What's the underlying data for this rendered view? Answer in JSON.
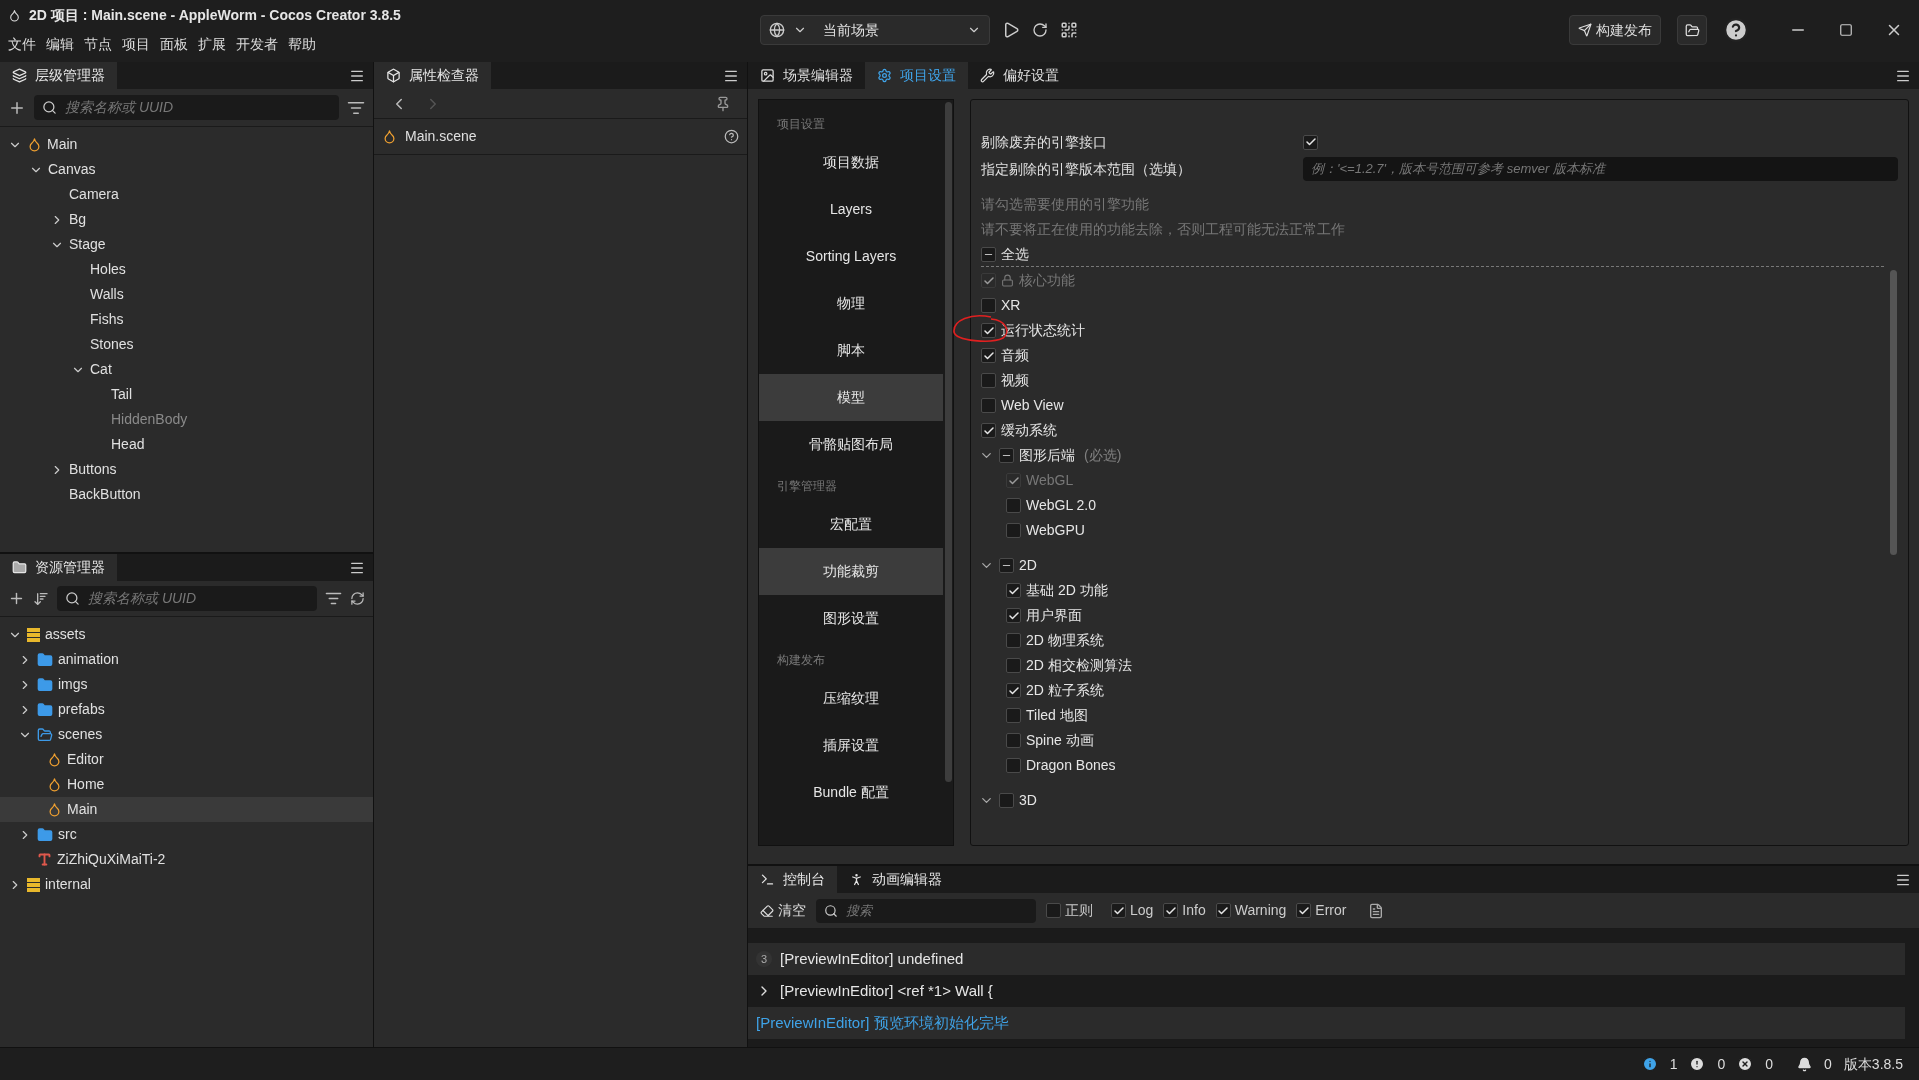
{
  "window": {
    "title": "2D 项目 : Main.scene - AppleWorm - Cocos Creator 3.8.5"
  },
  "menu": [
    "文件",
    "编辑",
    "节点",
    "项目",
    "面板",
    "扩展",
    "开发者",
    "帮助"
  ],
  "toolbar": {
    "scene_select": "当前场景",
    "build_button": "构建发布"
  },
  "hierarchy": {
    "tab": "层级管理器",
    "search_placeholder": "搜索名称或 UUID",
    "nodes": [
      {
        "label": "Main",
        "kind": "scene",
        "expanded": true,
        "disabled": false,
        "children": [
          {
            "label": "Canvas",
            "expanded": true,
            "disabled": false,
            "children": [
              {
                "label": "Camera",
                "disabled": false
              },
              {
                "label": "Bg",
                "expanded": false,
                "disabled": false
              },
              {
                "label": "Stage",
                "expanded": true,
                "disabled": false,
                "children": [
                  {
                    "label": "Holes",
                    "disabled": false
                  },
                  {
                    "label": "Walls",
                    "disabled": false
                  },
                  {
                    "label": "Fishs",
                    "disabled": false
                  },
                  {
                    "label": "Stones",
                    "disabled": false
                  },
                  {
                    "label": "Cat",
                    "expanded": true,
                    "disabled": false,
                    "children": [
                      {
                        "label": "Tail",
                        "disabled": false
                      },
                      {
                        "label": "HiddenBody",
                        "disabled": true
                      },
                      {
                        "label": "Head",
                        "disabled": false
                      }
                    ]
                  }
                ]
              },
              {
                "label": "Buttons",
                "expanded": false,
                "disabled": false
              },
              {
                "label": "BackButton",
                "disabled": false
              }
            ]
          }
        ]
      }
    ]
  },
  "inspector": {
    "tab": "属性检查器",
    "item": "Main.scene"
  },
  "assets": {
    "tab": "资源管理器",
    "search_placeholder": "搜索名称或 UUID",
    "nodes": [
      {
        "label": "assets",
        "kind": "database",
        "expanded": true,
        "selected": false,
        "children": [
          {
            "label": "animation",
            "kind": "folder",
            "expanded": false,
            "selected": false
          },
          {
            "label": "imgs",
            "kind": "folder",
            "expanded": false,
            "selected": false
          },
          {
            "label": "prefabs",
            "kind": "folder",
            "expanded": false,
            "selected": false
          },
          {
            "label": "scenes",
            "kind": "folder",
            "expanded": true,
            "selected": false,
            "children": [
              {
                "label": "Editor",
                "kind": "scene",
                "selected": false
              },
              {
                "label": "Home",
                "kind": "scene",
                "selected": false
              },
              {
                "label": "Main",
                "kind": "scene",
                "selected": true
              }
            ]
          },
          {
            "label": "src",
            "kind": "folder",
            "expanded": false,
            "selected": false
          },
          {
            "label": "ZiZhiQuXiMaiTi-2",
            "kind": "font",
            "selected": false
          }
        ]
      },
      {
        "label": "internal",
        "kind": "database",
        "expanded": false,
        "selected": false
      }
    ]
  },
  "main_tabs": [
    {
      "label": "场景编辑器",
      "selected": false
    },
    {
      "label": "项目设置",
      "selected": true
    },
    {
      "label": "偏好设置",
      "selected": false
    }
  ],
  "settings_nav": [
    {
      "kind": "heading",
      "label": "项目设置"
    },
    {
      "kind": "item",
      "label": "项目数据",
      "selected": false
    },
    {
      "kind": "item",
      "label": "Layers",
      "selected": false
    },
    {
      "kind": "item",
      "label": "Sorting Layers",
      "selected": false
    },
    {
      "kind": "item",
      "label": "物理",
      "selected": false
    },
    {
      "kind": "item",
      "label": "脚本",
      "selected": false
    },
    {
      "kind": "item",
      "label": "模型",
      "selected": true
    },
    {
      "kind": "item",
      "label": "骨骼贴图布局",
      "selected": false
    },
    {
      "kind": "heading",
      "label": "引擎管理器"
    },
    {
      "kind": "item",
      "label": "宏配置",
      "selected": false
    },
    {
      "kind": "item",
      "label": "功能裁剪",
      "selected": true
    },
    {
      "kind": "item",
      "label": "图形设置",
      "selected": false
    },
    {
      "kind": "heading",
      "label": "构建发布"
    },
    {
      "kind": "item",
      "label": "压缩纹理",
      "selected": false
    },
    {
      "kind": "item",
      "label": "插屏设置",
      "selected": false
    },
    {
      "kind": "item",
      "label": "Bundle 配置",
      "selected": false
    }
  ],
  "settings": {
    "remove_deprecated": {
      "label": "剔除废弃的引擎接口",
      "checked": true
    },
    "version_range": {
      "label": "指定剔除的引擎版本范围（选填）",
      "placeholder": "例：'<=1.2.7'，版本号范围可参考 semver 版本标准"
    },
    "hints": [
      "请勾选需要使用的引擎功能",
      "请不要将正在使用的功能去除，否则工程可能无法正常工作"
    ],
    "select_all": {
      "label": "全选",
      "indeterminate": true
    },
    "features": [
      {
        "kind": "locked",
        "label": "核心功能",
        "checked": true,
        "disabled": true
      },
      {
        "kind": "option",
        "label": "XR",
        "checked": false,
        "disabled": false
      },
      {
        "kind": "option",
        "label": "运行状态统计",
        "checked": true,
        "disabled": false
      },
      {
        "kind": "option",
        "label": "音频",
        "checked": true,
        "disabled": false
      },
      {
        "kind": "option",
        "label": "视频",
        "checked": false,
        "disabled": false
      },
      {
        "kind": "option",
        "label": "Web View",
        "checked": false,
        "disabled": false
      },
      {
        "kind": "option",
        "label": "缓动系统",
        "checked": true,
        "disabled": false
      },
      {
        "kind": "group",
        "label": "图形后端",
        "note": "(必选)",
        "indeterminate": true,
        "expanded": true,
        "disabled": false,
        "children": [
          {
            "kind": "option",
            "label": "WebGL",
            "checked": true,
            "disabled": true
          },
          {
            "kind": "option",
            "label": "WebGL 2.0",
            "checked": false,
            "disabled": false
          },
          {
            "kind": "option",
            "label": "WebGPU",
            "checked": false,
            "disabled": false
          }
        ]
      },
      {
        "kind": "group",
        "label": "2D",
        "indeterminate": true,
        "expanded": true,
        "disabled": false,
        "children": [
          {
            "kind": "option",
            "label": "基础 2D 功能",
            "checked": true,
            "disabled": false
          },
          {
            "kind": "option",
            "label": "用户界面",
            "checked": true,
            "disabled": false
          },
          {
            "kind": "option",
            "label": "2D 物理系统",
            "checked": false,
            "disabled": false
          },
          {
            "kind": "option",
            "label": "2D 相交检测算法",
            "checked": false,
            "disabled": false
          },
          {
            "kind": "option",
            "label": "2D 粒子系统",
            "checked": true,
            "disabled": false
          },
          {
            "kind": "option",
            "label": "Tiled 地图",
            "checked": false,
            "disabled": false
          },
          {
            "kind": "option",
            "label": "Spine 动画",
            "checked": false,
            "disabled": false
          },
          {
            "kind": "option",
            "label": "Dragon Bones",
            "checked": false,
            "disabled": false
          }
        ]
      },
      {
        "kind": "group",
        "label": "3D",
        "checked": false,
        "indeterminate": false,
        "expanded": true,
        "disabled": false
      }
    ]
  },
  "console": {
    "tabs": [
      {
        "label": "控制台",
        "selected": true
      },
      {
        "label": "动画编辑器",
        "selected": false
      }
    ],
    "clear_button": "清空",
    "search_placeholder": "搜索",
    "filters": [
      {
        "label": "正则",
        "checked": false
      },
      {
        "label": "Log",
        "checked": true
      },
      {
        "label": "Info",
        "checked": true
      },
      {
        "label": "Warning",
        "checked": true
      },
      {
        "label": "Error",
        "checked": true
      }
    ],
    "lines": [
      {
        "kind": "counted",
        "count": "3",
        "text": "[PreviewInEditor] undefined"
      },
      {
        "kind": "expandable",
        "text": "[PreviewInEditor] <ref *1> Wall {"
      },
      {
        "kind": "info",
        "text": "[PreviewInEditor] 预览环境初始化完毕"
      }
    ]
  },
  "status_bar": {
    "info": "1",
    "warnings": "0",
    "errors": "0",
    "notifications": "0",
    "version": "版本3.8.5"
  }
}
